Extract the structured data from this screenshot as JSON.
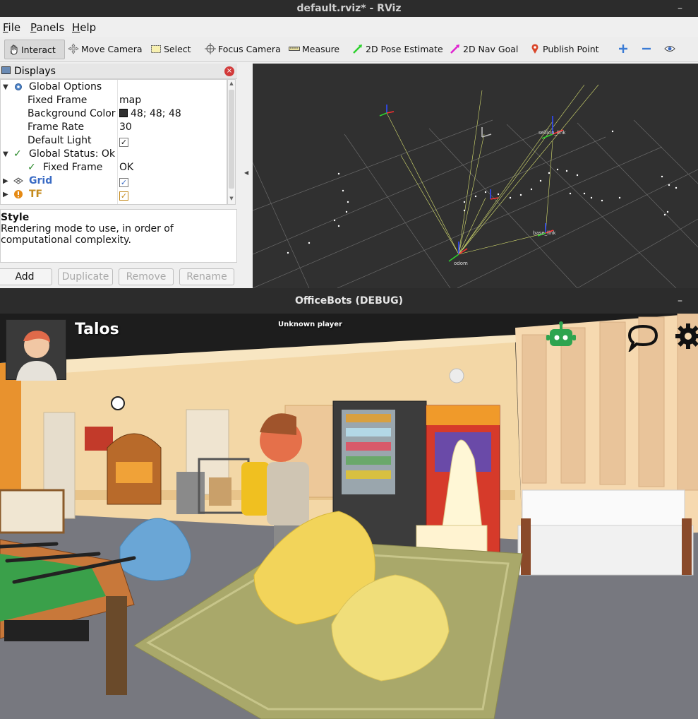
{
  "rviz": {
    "title": "default.rviz* - RViz",
    "window_button": "–",
    "menu": [
      {
        "label": "File",
        "underline": "F"
      },
      {
        "label": "Panels",
        "underline": "P"
      },
      {
        "label": "Help",
        "underline": "H"
      }
    ],
    "toolbar": {
      "interact": "Interact",
      "move_camera": "Move Camera",
      "select": "Select",
      "focus_camera": "Focus Camera",
      "measure": "Measure",
      "pose_estimate": "2D Pose Estimate",
      "nav_goal": "2D Nav Goal",
      "publish_point": "Publish Point"
    },
    "displays": {
      "title": "Displays",
      "rows": [
        {
          "name": "Global Options",
          "value": ""
        },
        {
          "name": "Fixed Frame",
          "value": "map"
        },
        {
          "name": "Background Color",
          "value": "48; 48; 48"
        },
        {
          "name": "Frame Rate",
          "value": "30"
        },
        {
          "name": "Default Light",
          "value": "✓"
        },
        {
          "name": "Global Status: Ok",
          "value": ""
        },
        {
          "name": "Fixed Frame",
          "value": "OK"
        },
        {
          "name": "Grid",
          "value": "✓"
        },
        {
          "name": "TF",
          "value": "✓"
        }
      ],
      "description_title": "Style",
      "description_text": "Rendering mode to use, in order of computational complexity.",
      "buttons": {
        "add": "Add",
        "duplicate": "Duplicate",
        "remove": "Remove",
        "rename": "Rename"
      }
    },
    "background_color": "#303030",
    "frames": {
      "odom": "odom",
      "sellion_link": "sellion_link",
      "base_link": "base_link"
    }
  },
  "officebots": {
    "title": "OfficeBots (DEBUG)",
    "window_button": "–",
    "player_name": "Talos",
    "unknown_player": "Unknown player",
    "robot_icon_color": "#2ea44f"
  }
}
